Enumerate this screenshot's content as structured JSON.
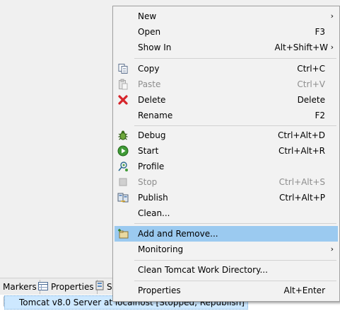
{
  "tabs": [
    {
      "label": "Markers"
    },
    {
      "label": "Properties"
    },
    {
      "label": "S"
    }
  ],
  "server": {
    "label": "Tomcat v8.0 Server at localhost  [Stopped, Republish]"
  },
  "menu": {
    "items": [
      {
        "label": "New",
        "accel": "",
        "submenu": true
      },
      {
        "label": "Open",
        "accel": "F3"
      },
      {
        "label": "Show In",
        "accel": "Alt+Shift+W",
        "submenu": true
      },
      {
        "label": "Copy",
        "accel": "Ctrl+C"
      },
      {
        "label": "Paste",
        "accel": "Ctrl+V",
        "disabled": true
      },
      {
        "label": "Delete",
        "accel": "Delete"
      },
      {
        "label": "Rename",
        "accel": "F2"
      },
      {
        "label": "Debug",
        "accel": "Ctrl+Alt+D"
      },
      {
        "label": "Start",
        "accel": "Ctrl+Alt+R"
      },
      {
        "label": "Profile",
        "accel": ""
      },
      {
        "label": "Stop",
        "accel": "Ctrl+Alt+S",
        "disabled": true
      },
      {
        "label": "Publish",
        "accel": "Ctrl+Alt+P"
      },
      {
        "label": "Clean...",
        "accel": ""
      },
      {
        "label": "Add and Remove...",
        "accel": "",
        "highlighted": true
      },
      {
        "label": "Monitoring",
        "accel": "",
        "submenu": true
      },
      {
        "label": "Clean Tomcat Work Directory...",
        "accel": ""
      },
      {
        "label": "Properties",
        "accel": "Alt+Enter"
      }
    ]
  },
  "colors": {
    "highlight": "#9bcaf0",
    "menu_bg": "#f2f2f2",
    "disabled_text": "#8d8d8d"
  }
}
